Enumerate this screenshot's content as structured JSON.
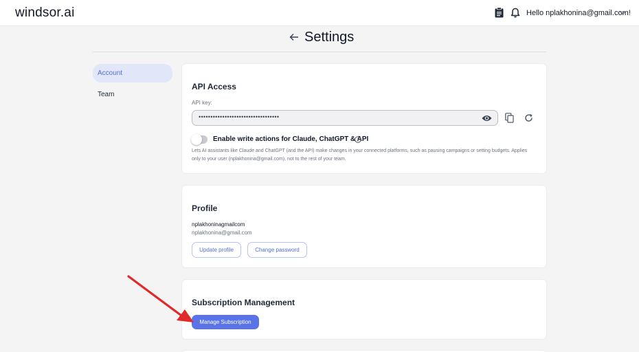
{
  "app": {
    "logo": "windsor.ai"
  },
  "topbar": {
    "greeting": "Hello nplakhonina@gmail.com!",
    "icons": [
      "clipboard-icon",
      "bell-icon",
      "chevron-down-icon"
    ]
  },
  "header": {
    "title": "Settings",
    "back_icon": "arrow-left-icon"
  },
  "sidebar": {
    "items": [
      {
        "label": "Account",
        "active": true
      },
      {
        "label": "Team",
        "active": false
      }
    ]
  },
  "api_access": {
    "title": "API Access",
    "key_label": "API key:",
    "key_value": "••••••••••••••••••••••••••••••••••",
    "toggle_label": "Enable write actions for Claude, ChatGPT & API",
    "toggle_on": false,
    "description": "Lets AI assistants like Claude and ChatGPT (and the API) make changes in your connected platforms, such as pausing campaigns or setting budgets. Applies only to your user (nplakhonina@gmail.com), not to the rest of your team."
  },
  "profile": {
    "title": "Profile",
    "name": "nplakhoninagmailcom",
    "email": "nplakhonina@gmail.com",
    "update_button": "Update profile",
    "password_button": "Change password"
  },
  "subscription": {
    "title": "Subscription Management",
    "manage_button": "Manage Subscription"
  },
  "colors": {
    "accent": "#5b73e8",
    "active_nav_bg": "#e1e7f8",
    "annotation_arrow": "#e02a2a"
  }
}
